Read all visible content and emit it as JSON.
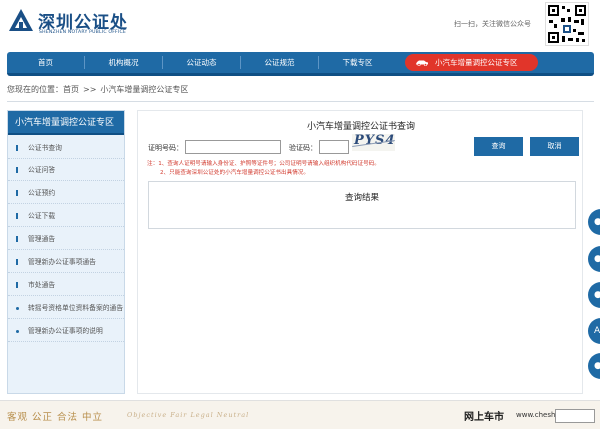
{
  "header": {
    "logo_cn": "深圳公证处",
    "logo_en": "SHENZHEN NOTARY PUBLIC OFFICE",
    "qr_text": "扫一扫，关注微信公众号"
  },
  "nav": {
    "items": [
      "首页",
      "机构概况",
      "公证动态",
      "公证规范",
      "下载专区"
    ],
    "special": "小汽车增量调控公证专区"
  },
  "breadcrumb": {
    "label": "您现在的位置：",
    "home": "首页",
    "sep": ">>",
    "current": "小汽车增量调控公证专区"
  },
  "sidebar": {
    "title": "小汽车增量调控公证专区",
    "items": [
      {
        "label": "公证书查询",
        "marker": "bar"
      },
      {
        "label": "公证问答",
        "marker": "bar"
      },
      {
        "label": "公证预约",
        "marker": "bar"
      },
      {
        "label": "公证下载",
        "marker": "bar"
      },
      {
        "label": "管理通告",
        "marker": "bar"
      },
      {
        "label": "管理新办公证事项通告",
        "marker": "bar"
      },
      {
        "label": "市处通告",
        "marker": "bar"
      },
      {
        "label": "转摇号资格单位资料备案的通告",
        "marker": "dot"
      },
      {
        "label": "管理新办公证事项的说明",
        "marker": "dot"
      }
    ]
  },
  "main": {
    "title": "小汽车增量调控公证书查询",
    "cert_label": "证明号码：",
    "code_label": "验证码：",
    "captcha": "PYS4",
    "query_btn": "查询",
    "cancel_btn": "取消",
    "note1": "注：1、查询人证明号请输入身份证、护照等证件号；公司证明号请输入组织机构代码证号码。",
    "note2": "2、只能查询深圳公证处的小汽车增量调控公证书出具情况。",
    "result_title": "查询结果"
  },
  "footer": {
    "motto": "客观  公正  合法  中立",
    "motto_en": "Objective  Fair  Legal  Neutral"
  },
  "watermark": {
    "text": "网上车市",
    "url": "www.cheshi.com"
  },
  "colors": {
    "primary": "#1f6aa5",
    "accent": "#e1352a"
  }
}
